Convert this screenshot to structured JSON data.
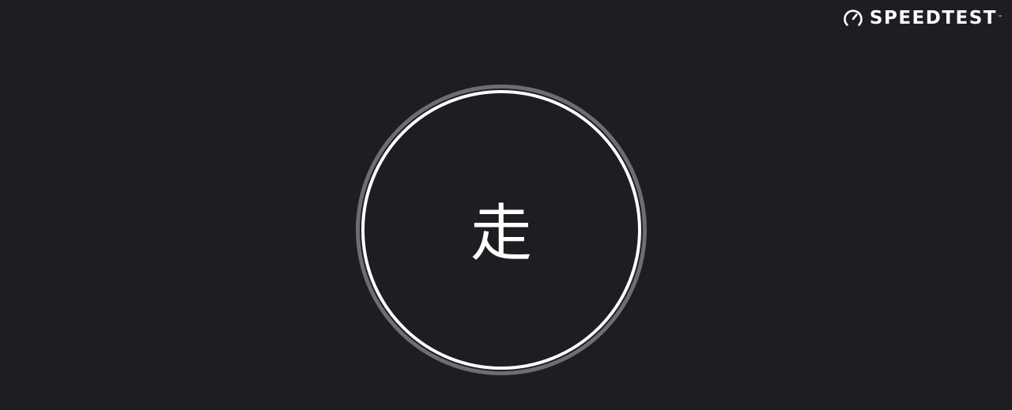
{
  "brand": {
    "name": "SPEEDTEST",
    "trademark": "™",
    "icon": "speedometer-icon"
  },
  "go_button": {
    "label": "走"
  },
  "colors": {
    "background": "#1e1d22",
    "ring_outer": "#6e6d70",
    "ring_inner": "#ffffff",
    "text": "#ffffff"
  }
}
